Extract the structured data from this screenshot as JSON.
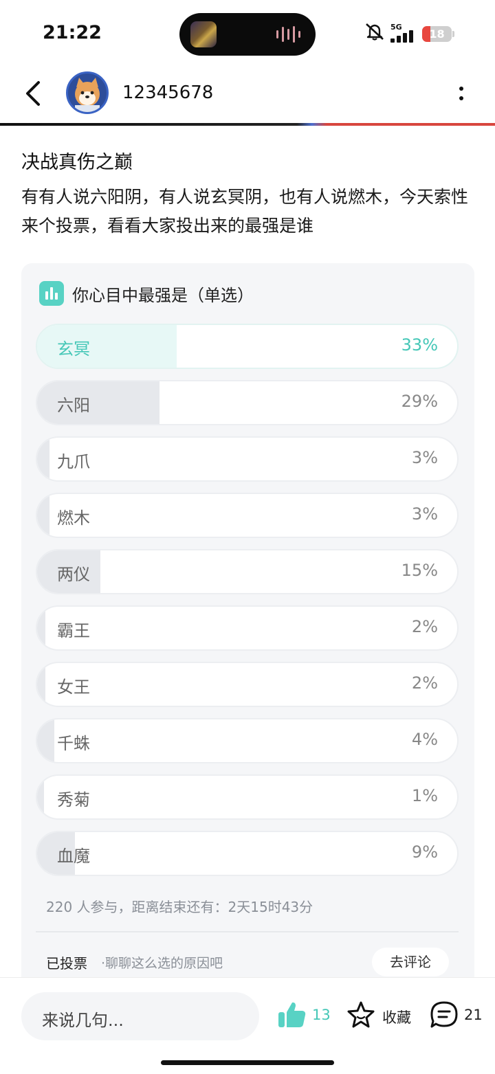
{
  "status_bar": {
    "time": "21:22",
    "network": "5G",
    "battery": "18",
    "icons": [
      "mute-bell-icon",
      "signal-bars-icon",
      "battery-icon"
    ]
  },
  "nav": {
    "username": "12345678",
    "back_icon": "chevron-left-icon",
    "more_icon": "more-vertical-icon"
  },
  "post": {
    "title": "决战真伤之巅",
    "body": "有有人说六阳阴，有人说玄冥阴，也有人说燃木，今天索性来个投票，看看大家投出来的最强是谁"
  },
  "poll": {
    "question": "你心目中最强是（单选）",
    "options": [
      {
        "label": "玄冥",
        "percent": 33,
        "percent_text": "33%",
        "selected": true
      },
      {
        "label": "六阳",
        "percent": 29,
        "percent_text": "29%",
        "selected": false
      },
      {
        "label": "九爪",
        "percent": 3,
        "percent_text": "3%",
        "selected": false
      },
      {
        "label": "燃木",
        "percent": 3,
        "percent_text": "3%",
        "selected": false
      },
      {
        "label": "两仪",
        "percent": 15,
        "percent_text": "15%",
        "selected": false
      },
      {
        "label": "霸王",
        "percent": 2,
        "percent_text": "2%",
        "selected": false
      },
      {
        "label": "女王",
        "percent": 2,
        "percent_text": "2%",
        "selected": false
      },
      {
        "label": "千蛛",
        "percent": 4,
        "percent_text": "4%",
        "selected": false
      },
      {
        "label": "秀菊",
        "percent": 1,
        "percent_text": "1%",
        "selected": false
      },
      {
        "label": "血魔",
        "percent": 9,
        "percent_text": "9%",
        "selected": false
      }
    ],
    "meta": "220 人参与，距离结束还有：2天15时43分",
    "vote_status": "已投票",
    "vote_hint": "·聊聊这么选的原因吧",
    "comment_button": "去评论"
  },
  "bottom_bar": {
    "input_placeholder": "来说几句...",
    "like_count": "13",
    "favorite_label": "收藏",
    "comment_count": "21"
  },
  "colors": {
    "accent": "#45c7b7",
    "selected_fill": "#e7f8f6",
    "option_fill": "#e6e8ec",
    "card_bg": "#f5f6f8"
  }
}
